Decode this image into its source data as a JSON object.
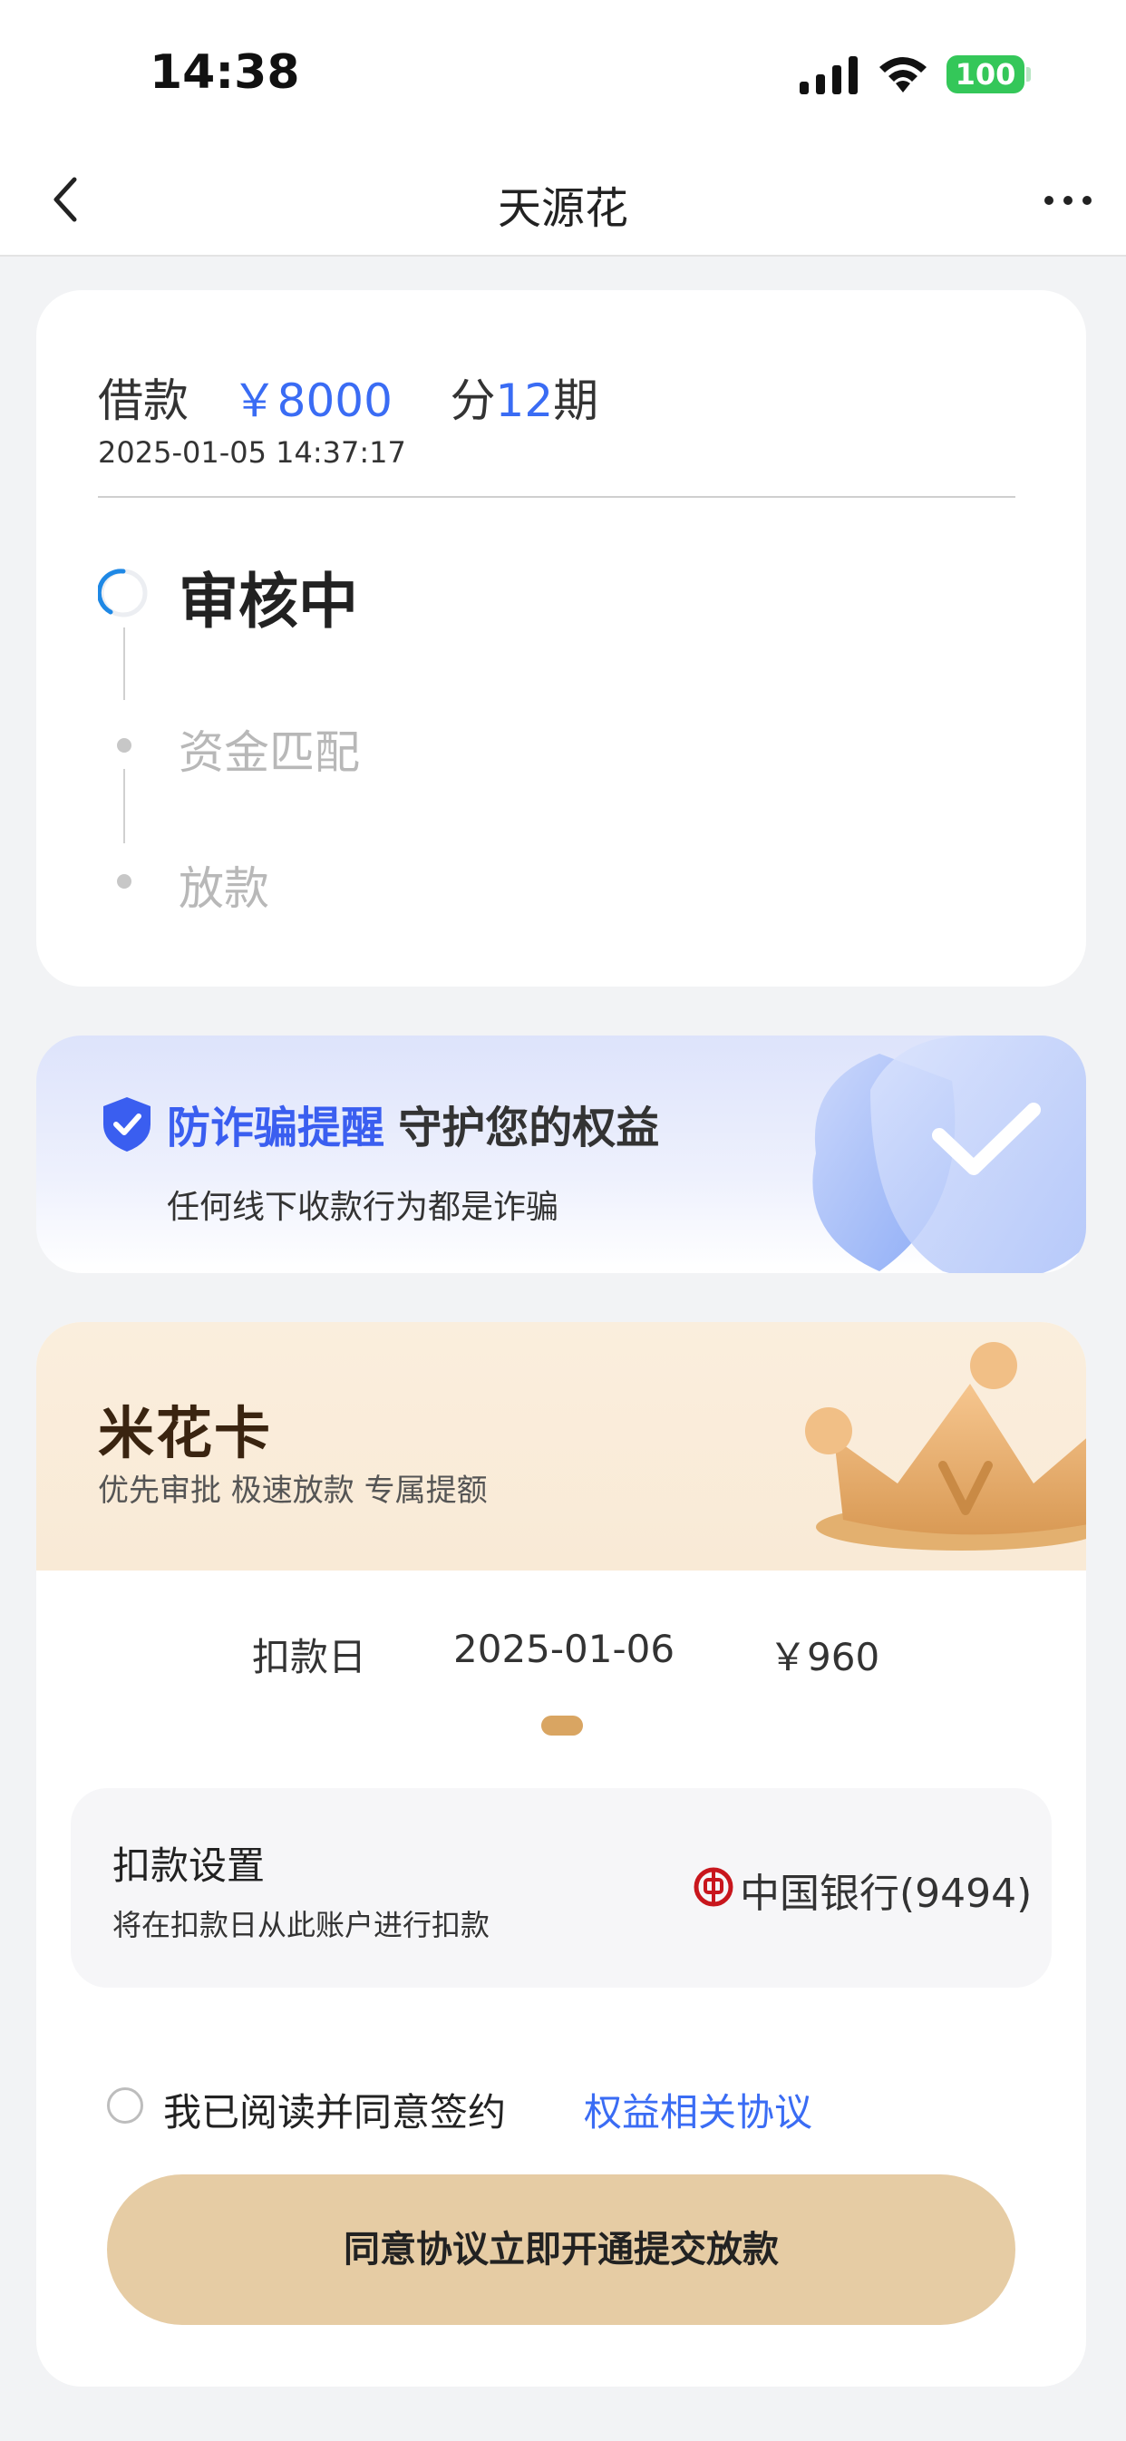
{
  "status_bar": {
    "time": "14:38",
    "battery": "100"
  },
  "nav": {
    "title": "天源花",
    "back_icon": "chevron-left-icon",
    "more_icon": "ellipsis-icon"
  },
  "loan": {
    "label": "借款",
    "amount": "￥8000",
    "term_prefix": "分",
    "term_count": "12",
    "term_suffix": "期",
    "date": "2025-01-05 14:37:17",
    "steps": [
      {
        "label": "审核中",
        "state": "active"
      },
      {
        "label": "资金匹配",
        "state": "pending"
      },
      {
        "label": "放款",
        "state": "pending"
      }
    ]
  },
  "fraud": {
    "title_accent": "防诈骗提醒",
    "title_rest": "守护您的权益",
    "subtitle": "任何线下收款行为都是诈骗",
    "accent_color": "#3a5ef0"
  },
  "vip": {
    "title": "米花卡",
    "subtitle": "优先审批 极速放款 专属提额",
    "deduct_label": "扣款日",
    "deduct_date": "2025-01-06",
    "deduct_amount": "￥960",
    "setting_title": "扣款设置",
    "setting_sub": "将在扣款日从此账户进行扣款",
    "bank": "中国银行(9494)",
    "agree_text": "我已阅读并同意签约",
    "agree_link": "权益相关协议",
    "submit_label": "同意协议立即开通提交放款",
    "button_color": "#e6cca4"
  }
}
